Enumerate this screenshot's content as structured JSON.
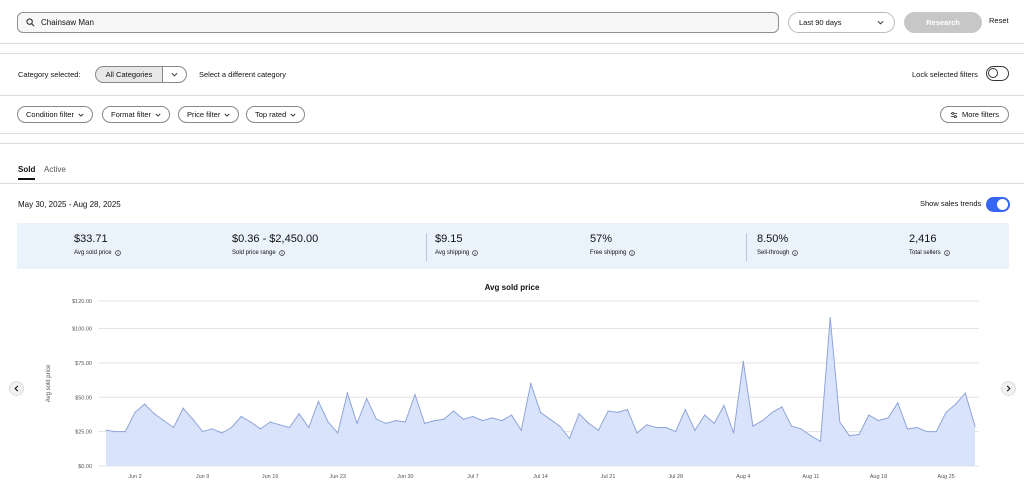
{
  "search": {
    "query": "Chainsaw Man",
    "period": "Last 90 days",
    "research_label": "Research",
    "reset_label": "Reset"
  },
  "category": {
    "label": "Category selected:",
    "selected": "All Categories",
    "other": "Select a different category",
    "lock_label": "Lock selected filters"
  },
  "filters": [
    "Condition filter",
    "Format filter",
    "Price filter",
    "Top rated"
  ],
  "more_filters": "More filters",
  "tabs": {
    "sold": "Sold",
    "active": "Active"
  },
  "date_range": "May 30, 2025 - Aug 28, 2025",
  "trends_label": "Show sales trends",
  "stats": [
    {
      "value": "$33.71",
      "label": "Avg sold price"
    },
    {
      "value": "$0.36 - $2,450.00",
      "label": "Sold price range"
    },
    {
      "value": "$9.15",
      "label": "Avg shipping"
    },
    {
      "value": "57%",
      "label": "Free shipping"
    },
    {
      "value": "8.50%",
      "label": "Sell-through"
    },
    {
      "value": "2,416",
      "label": "Total sellers"
    }
  ],
  "colors": {
    "accent": "#3665f3",
    "area_fill": "#d9e3fb",
    "area_stroke": "#8fa5d8",
    "stats_bg": "#eaf2fb"
  },
  "chart_data": {
    "type": "area",
    "title": "Avg sold price",
    "ylabel": "Avg sold price",
    "xlabel": "",
    "ylim": [
      0,
      120
    ],
    "y_tick_labels": [
      "$0.00",
      "$25.00",
      "$50.00",
      "$75.00",
      "$100.00",
      "$120.00"
    ],
    "y_tick_values": [
      0,
      25,
      50,
      75,
      100,
      120
    ],
    "x_tick_labels": [
      "Jun 2",
      "Jun 9",
      "Jun 16",
      "Jun 23",
      "Jun 30",
      "Jul 7",
      "Jul 14",
      "Jul 21",
      "Jul 28",
      "Aug 4",
      "Aug 11",
      "Aug 18",
      "Aug 25"
    ],
    "x_tick_dates": [
      "2025-06-02",
      "2025-06-09",
      "2025-06-16",
      "2025-06-23",
      "2025-06-30",
      "2025-07-07",
      "2025-07-14",
      "2025-07-21",
      "2025-07-28",
      "2025-08-04",
      "2025-08-11",
      "2025-08-18",
      "2025-08-25"
    ],
    "x": [
      "2025-05-30",
      "2025-05-31",
      "2025-06-01",
      "2025-06-02",
      "2025-06-03",
      "2025-06-04",
      "2025-06-05",
      "2025-06-06",
      "2025-06-07",
      "2025-06-08",
      "2025-06-09",
      "2025-06-10",
      "2025-06-11",
      "2025-06-12",
      "2025-06-13",
      "2025-06-14",
      "2025-06-15",
      "2025-06-16",
      "2025-06-17",
      "2025-06-18",
      "2025-06-19",
      "2025-06-20",
      "2025-06-21",
      "2025-06-22",
      "2025-06-23",
      "2025-06-24",
      "2025-06-25",
      "2025-06-26",
      "2025-06-27",
      "2025-06-28",
      "2025-06-29",
      "2025-06-30",
      "2025-07-01",
      "2025-07-02",
      "2025-07-03",
      "2025-07-04",
      "2025-07-05",
      "2025-07-06",
      "2025-07-07",
      "2025-07-08",
      "2025-07-09",
      "2025-07-10",
      "2025-07-11",
      "2025-07-12",
      "2025-07-13",
      "2025-07-14",
      "2025-07-15",
      "2025-07-16",
      "2025-07-17",
      "2025-07-18",
      "2025-07-19",
      "2025-07-20",
      "2025-07-21",
      "2025-07-22",
      "2025-07-23",
      "2025-07-24",
      "2025-07-25",
      "2025-07-26",
      "2025-07-27",
      "2025-07-28",
      "2025-07-29",
      "2025-07-30",
      "2025-07-31",
      "2025-08-01",
      "2025-08-02",
      "2025-08-03",
      "2025-08-04",
      "2025-08-05",
      "2025-08-06",
      "2025-08-07",
      "2025-08-08",
      "2025-08-09",
      "2025-08-10",
      "2025-08-11",
      "2025-08-12",
      "2025-08-13",
      "2025-08-14",
      "2025-08-15",
      "2025-08-16",
      "2025-08-17",
      "2025-08-18",
      "2025-08-19",
      "2025-08-20",
      "2025-08-21",
      "2025-08-22",
      "2025-08-23",
      "2025-08-24",
      "2025-08-25",
      "2025-08-26",
      "2025-08-27",
      "2025-08-28"
    ],
    "values": [
      26,
      25,
      25,
      39,
      45,
      38,
      33,
      28,
      42,
      34,
      25,
      27,
      24,
      28,
      36,
      32,
      27,
      32,
      30,
      28,
      38,
      28,
      47,
      32,
      24,
      53,
      31,
      49,
      34,
      31,
      33,
      32,
      52,
      31,
      33,
      34,
      40,
      34,
      36,
      33,
      35,
      33,
      37,
      26,
      60,
      39,
      34,
      29,
      20,
      38,
      31,
      26,
      40,
      39,
      41,
      24,
      30,
      28,
      28,
      25,
      41,
      26,
      37,
      31,
      44,
      24,
      76,
      29,
      33,
      39,
      43,
      29,
      27,
      22,
      18,
      108,
      32,
      22,
      23,
      37,
      33,
      35,
      46,
      27,
      28,
      25,
      25,
      39,
      45,
      53,
      29,
      29
    ]
  }
}
